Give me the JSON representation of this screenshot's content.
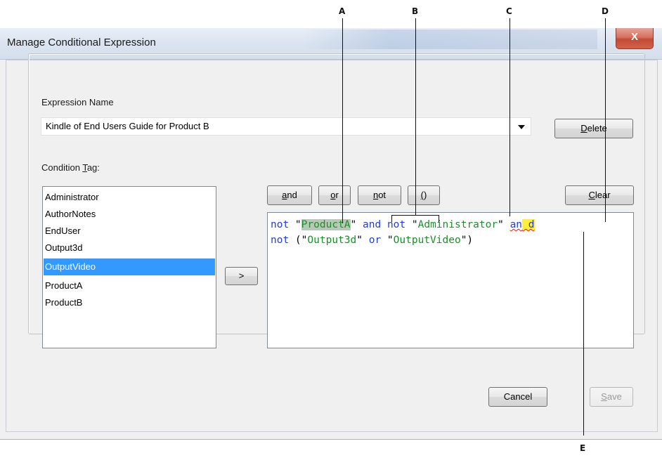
{
  "window": {
    "title": "Manage Conditional Expression",
    "close_glyph": "X"
  },
  "expression_name": {
    "label": "Expression Name",
    "value": "Kindle of End Users Guide for Product B"
  },
  "buttons": {
    "delete": {
      "pre": "",
      "key": "D",
      "post": "elete"
    },
    "clear": {
      "pre": "",
      "key": "C",
      "post": "lear"
    },
    "and": {
      "pre": "",
      "key": "a",
      "post": "nd"
    },
    "or": {
      "pre": "",
      "key": "o",
      "post": "r"
    },
    "not": {
      "pre": "",
      "key": "n",
      "post": "ot"
    },
    "paren": {
      "pre": "",
      "key": "(",
      "post": ")"
    },
    "insert": ">",
    "cancel": "Cancel",
    "save": {
      "pre": "",
      "key": "S",
      "post": "ave"
    }
  },
  "condition_tag": {
    "label_pre": "Condition ",
    "label_key": "T",
    "label_post": "ag:",
    "items": [
      "Administrator",
      "AuthorNotes",
      "EndUser",
      "Output3d",
      "OutputVideo",
      "ProductA",
      "ProductB"
    ],
    "selected": "OutputVideo"
  },
  "expression_editor": {
    "line1": {
      "t1": "not",
      "t2": " \"",
      "t3a": "Produc",
      "t3b": "tA",
      "t4": "\" ",
      "t5": "and",
      "t6": " ",
      "t7": "not",
      "t8": " \"",
      "t9": "Administrator",
      "t10": "\" ",
      "t11": "an",
      "t12": " d"
    },
    "line2": {
      "t1": "not",
      "t2": " (\"",
      "t3": "Output3d",
      "t4": "\" ",
      "t5": "or",
      "t6": " \"",
      "t7": "OutputVideo",
      "t8": "\")"
    }
  },
  "callouts": {
    "a": "A",
    "b": "B",
    "c": "C",
    "d": "D",
    "e": "E"
  },
  "colors": {
    "keyword": "#1f3fd6",
    "string": "#1b8f2a",
    "selection": "#3399ff",
    "highlight_gray": "#b9c7b9",
    "highlight_yellow": "#ffef3a",
    "error_squiggle": "#e0201a"
  }
}
